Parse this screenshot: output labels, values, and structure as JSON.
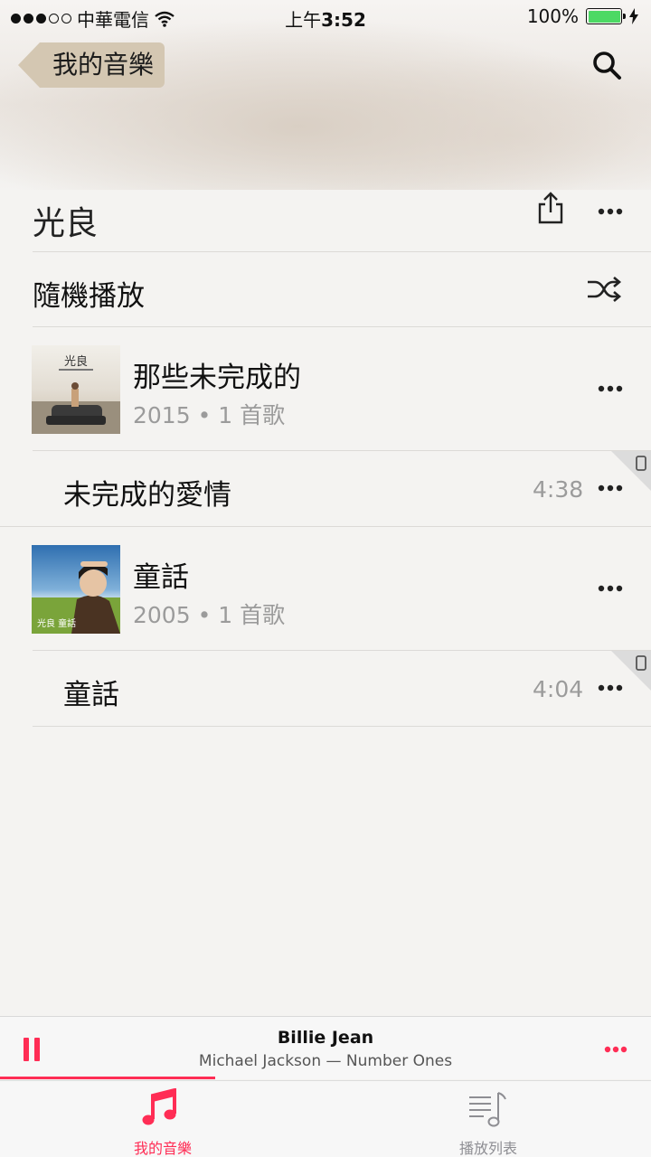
{
  "status_bar": {
    "carrier": "中華電信",
    "time_prefix": "上午",
    "time": "3:52",
    "battery": "100%"
  },
  "nav": {
    "back_label": "我的音樂"
  },
  "artist": {
    "name": "光良"
  },
  "shuffle": {
    "label": "隨機播放"
  },
  "albums": [
    {
      "title": "那些未完成的",
      "meta": "2015 • 1 首歌",
      "art_text": "光良",
      "songs": [
        {
          "title": "未完成的愛情",
          "duration": "4:38"
        }
      ]
    },
    {
      "title": "童話",
      "meta": "2005 • 1 首歌",
      "art_text": "光良 童話",
      "songs": [
        {
          "title": "童話",
          "duration": "4:04"
        }
      ]
    }
  ],
  "now_playing": {
    "title": "Billie Jean",
    "subtitle": "Michael Jackson — Number Ones",
    "progress": 0.33
  },
  "tabs": [
    {
      "label": "我的音樂",
      "icon": "music-note-icon",
      "active": true
    },
    {
      "label": "播放列表",
      "icon": "playlist-icon",
      "active": false
    }
  ],
  "colors": {
    "accent": "#ff2d55",
    "battery": "#4cd964",
    "back_button": "#d4c7b2"
  }
}
